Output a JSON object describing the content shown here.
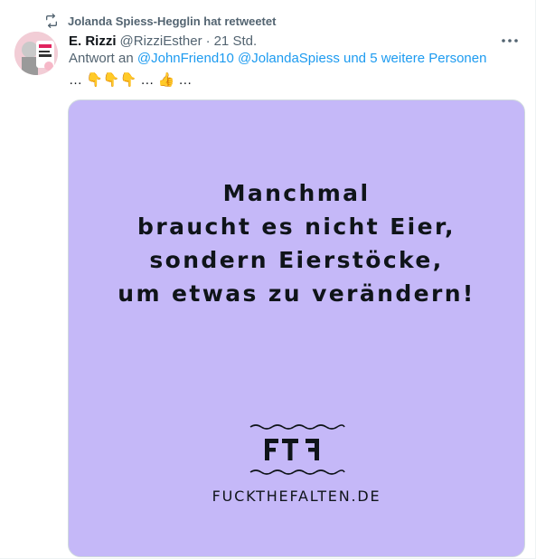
{
  "retweet": {
    "text": "Jolanda Spiess-Hegglin hat retweetet",
    "icon": "retweet-icon"
  },
  "tweet": {
    "author_name": "E. Rizzi",
    "handle": "@RizziEsther",
    "separator": "·",
    "time": "21 Std.",
    "more_label": "···",
    "reply": {
      "prefix": "Antwort an",
      "mention_1": "@JohnFriend10",
      "mention_2": "@JolandaSpiess",
      "suffix": "und 5 weitere Personen"
    },
    "text": "… 👇👇👇 … 👍 …"
  },
  "media": {
    "background": "#c5b8f8",
    "quote_lines": [
      "Manchmal",
      "braucht es nicht Eier,",
      "sondern Eierstöcke,",
      "um etwas zu verändern!"
    ],
    "logo_text": "FTF",
    "site": "FUCKTHEFALTEN.DE"
  },
  "colors": {
    "accent": "#1d9bf0",
    "secondary_text": "#536471",
    "primary_text": "#0f1419"
  }
}
